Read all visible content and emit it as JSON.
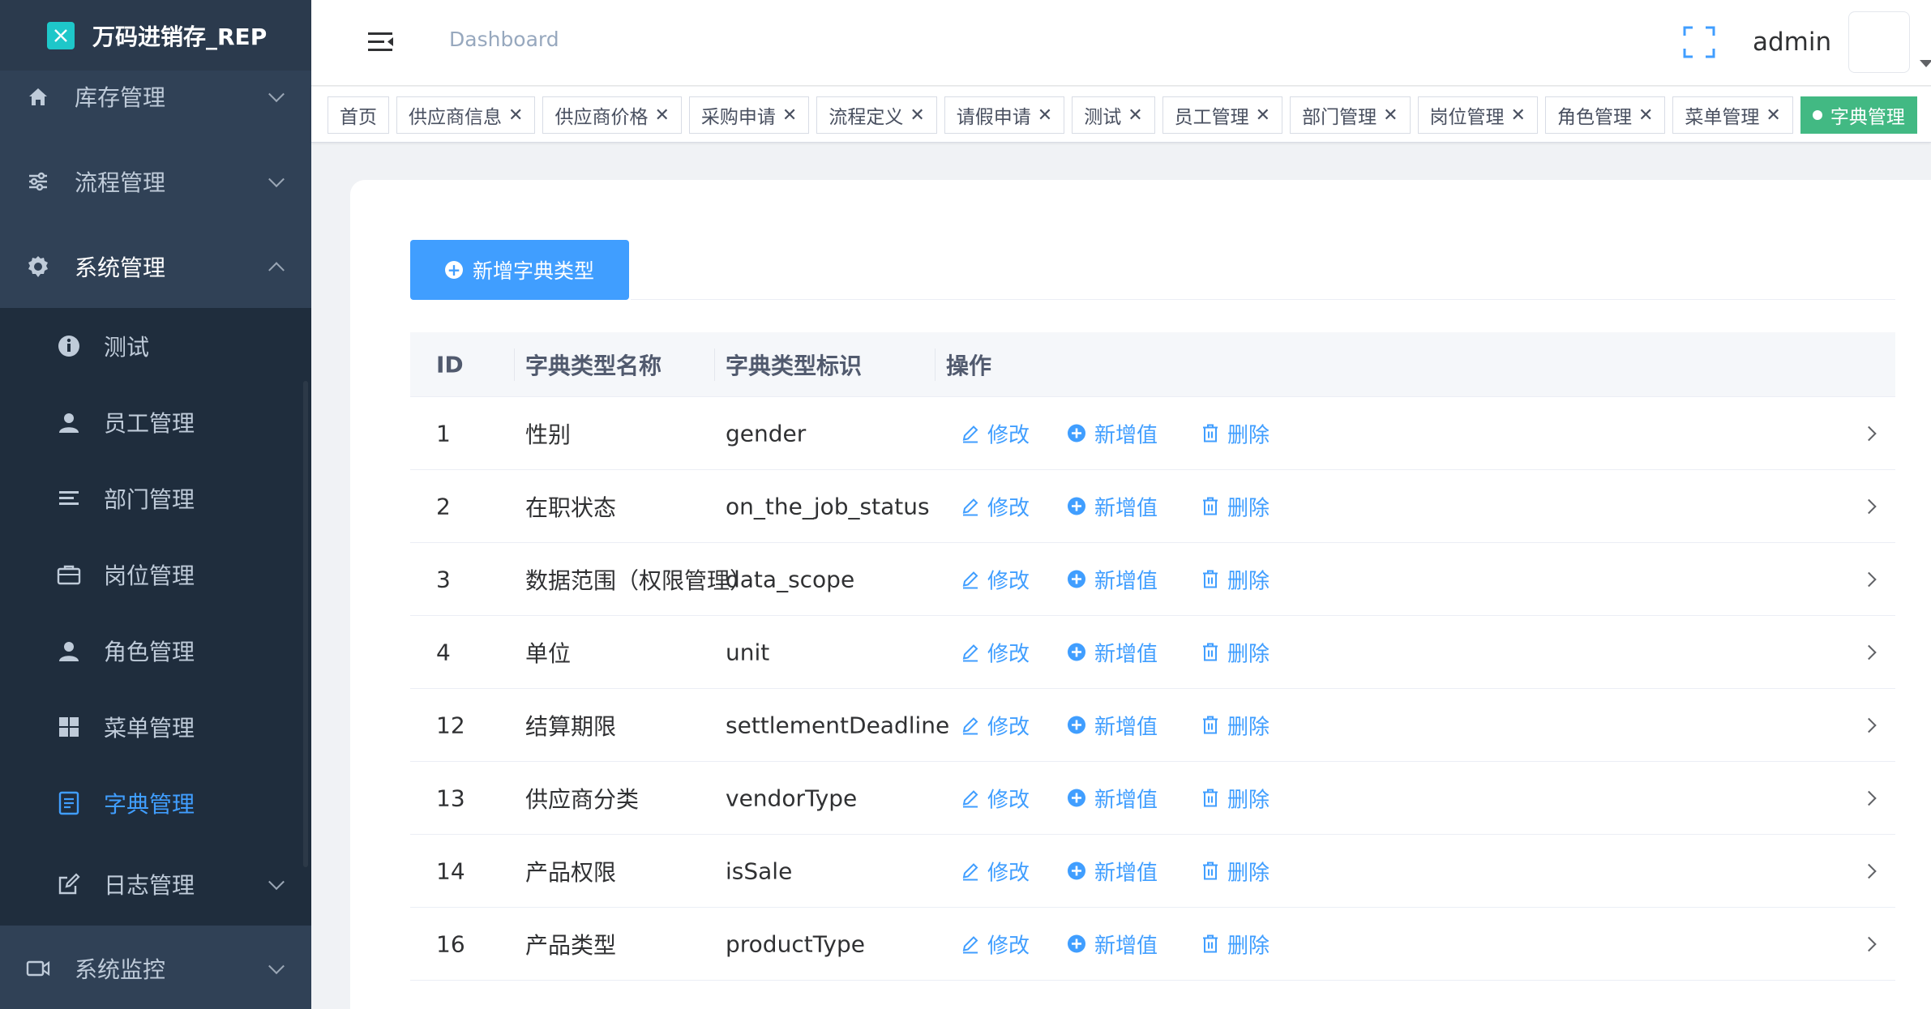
{
  "app": {
    "title": "万码进销存_REP",
    "logo_glyph": "℀"
  },
  "header": {
    "breadcrumb": "Dashboard",
    "username": "admin"
  },
  "sidebar": {
    "top": [
      {
        "label": "库存管理",
        "icon": "home-icon"
      },
      {
        "label": "流程管理",
        "icon": "sliders-icon"
      },
      {
        "label": "系统管理",
        "icon": "gear-icon"
      }
    ],
    "sub": [
      {
        "label": "测试",
        "icon": "info-icon"
      },
      {
        "label": "员工管理",
        "icon": "user-icon"
      },
      {
        "label": "部门管理",
        "icon": "list-icon"
      },
      {
        "label": "岗位管理",
        "icon": "briefcase-icon"
      },
      {
        "label": "角色管理",
        "icon": "user-icon"
      },
      {
        "label": "菜单管理",
        "icon": "grid-icon"
      },
      {
        "label": "字典管理",
        "icon": "document-icon"
      },
      {
        "label": "日志管理",
        "icon": "edit-icon"
      }
    ],
    "bottom": {
      "label": "系统监控",
      "icon": "video-icon"
    }
  },
  "tags": [
    {
      "label": "首页",
      "closable": false
    },
    {
      "label": "供应商信息",
      "closable": true
    },
    {
      "label": "供应商价格",
      "closable": true
    },
    {
      "label": "采购申请",
      "closable": true
    },
    {
      "label": "流程定义",
      "closable": true
    },
    {
      "label": "请假申请",
      "closable": true
    },
    {
      "label": "测试",
      "closable": true
    },
    {
      "label": "员工管理",
      "closable": true
    },
    {
      "label": "部门管理",
      "closable": true
    },
    {
      "label": "岗位管理",
      "closable": true
    },
    {
      "label": "角色管理",
      "closable": true
    },
    {
      "label": "菜单管理",
      "closable": true
    },
    {
      "label": "字典管理",
      "closable": false,
      "active": true
    }
  ],
  "toolbar": {
    "add_label": "新增字典类型"
  },
  "table": {
    "headers": {
      "id": "ID",
      "name": "字典类型名称",
      "key": "字典类型标识",
      "ops": "操作"
    },
    "actions": {
      "edit": "修改",
      "add_value": "新增值",
      "delete": "删除"
    },
    "rows": [
      {
        "id": "1",
        "name": "性别",
        "key": "gender"
      },
      {
        "id": "2",
        "name": "在职状态",
        "key": "on_the_job_status"
      },
      {
        "id": "3",
        "name": "数据范围（权限管理）",
        "key": "data_scope"
      },
      {
        "id": "4",
        "name": "单位",
        "key": "unit"
      },
      {
        "id": "12",
        "name": "结算期限",
        "key": "settlementDeadline"
      },
      {
        "id": "13",
        "name": "供应商分类",
        "key": "vendorType"
      },
      {
        "id": "14",
        "name": "产品权限",
        "key": "isSale"
      },
      {
        "id": "16",
        "name": "产品类型",
        "key": "productType"
      }
    ]
  },
  "colors": {
    "accent": "#409eff",
    "sidebar": "#304156",
    "submenu": "#1f2d3d",
    "active_tag": "#42b983"
  }
}
